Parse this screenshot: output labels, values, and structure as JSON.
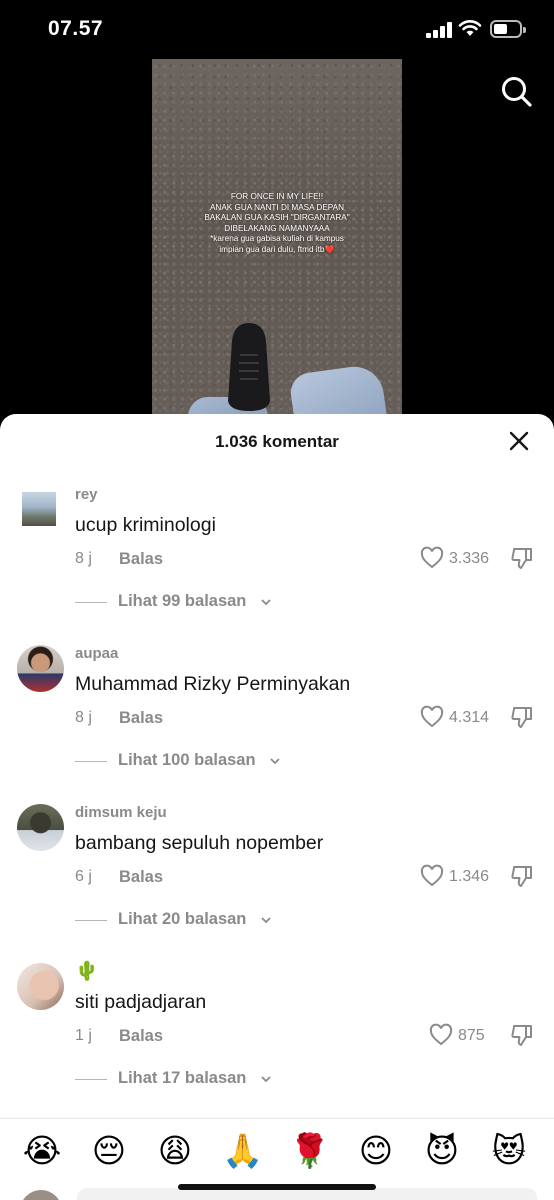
{
  "status": {
    "time": "07.57"
  },
  "video": {
    "caption_lines": [
      "FOR ONCE IN MY LIFE!!",
      "ANAK GUA NANTI DI MASA DEPAN",
      "BAKALAN GUA KASIH \"DIRGANTARA\"",
      "DIBELAKANG NAMANYAAA",
      "*karena gua gabisa kuliah di kampus",
      "impian gua dari dulu, ftmd itb❤️"
    ]
  },
  "sheet": {
    "title": "1.036 komentar"
  },
  "comments": [
    {
      "user": "rey",
      "text": "ucup kriminologi",
      "time": "8 j",
      "reply": "Balas",
      "likes": "3.336",
      "view_replies": "Lihat 99 balasan"
    },
    {
      "user": "aupaa",
      "text": "Muhammad Rizky Perminyakan",
      "time": "8 j",
      "reply": "Balas",
      "likes": "4.314",
      "view_replies": "Lihat 100 balasan"
    },
    {
      "user": "dimsum keju",
      "text": "bambang sepuluh nopember",
      "time": "6 j",
      "reply": "Balas",
      "likes": "1.346",
      "view_replies": "Lihat 20 balasan"
    },
    {
      "user": "🌵",
      "text": "siti padjadjaran",
      "time": "1 j",
      "reply": "Balas",
      "likes": "875",
      "view_replies": "Lihat 17 balasan"
    }
  ],
  "emojis": [
    "😭",
    "😔",
    "😩",
    "🙏",
    "🌹",
    "😊",
    "😈",
    "😻"
  ],
  "colors": {
    "secondary_text": "#8a8a8a",
    "primary_text": "#161616",
    "heart_red": "#e8253a"
  },
  "status_indicators": {
    "battery_level": 0.5
  }
}
